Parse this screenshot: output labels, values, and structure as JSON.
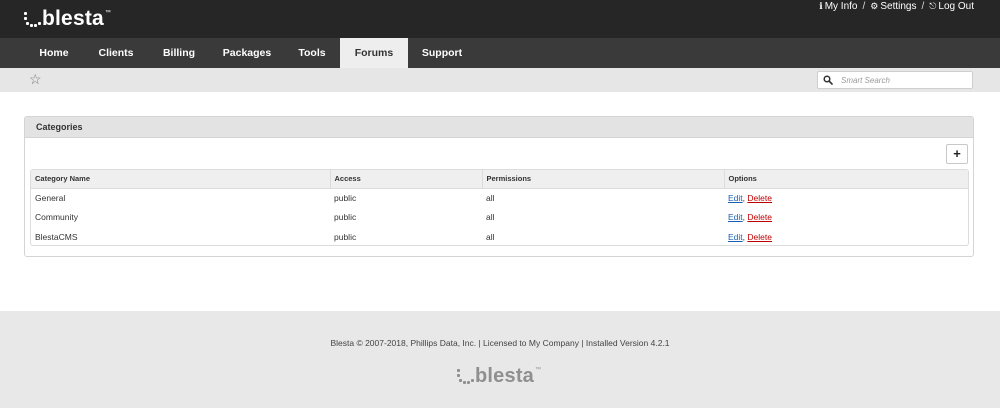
{
  "header": {
    "logo_text": "blesta",
    "logo_tm": "™",
    "links": [
      {
        "label": "My Info",
        "icon": "info-icon"
      },
      {
        "label": "Settings",
        "icon": "gear-icon"
      },
      {
        "label": "Log Out",
        "icon": "logout-icon"
      }
    ],
    "separator": "/"
  },
  "nav": {
    "tabs": [
      {
        "label": "Home"
      },
      {
        "label": "Clients"
      },
      {
        "label": "Billing"
      },
      {
        "label": "Packages"
      },
      {
        "label": "Tools"
      },
      {
        "label": "Forums",
        "active": true
      },
      {
        "label": "Support"
      }
    ]
  },
  "subbar": {
    "star_icon": "star-icon",
    "search_placeholder": "Smart Search"
  },
  "panel": {
    "title": "Categories",
    "add_button": "+",
    "columns": [
      "Category Name",
      "Access",
      "Permissions",
      "Options"
    ],
    "rows": [
      {
        "name": "General",
        "access": "public",
        "permissions": "all",
        "edit": "Edit",
        "comma": ",",
        "delete": "Delete"
      },
      {
        "name": "Community",
        "access": "public",
        "permissions": "all",
        "edit": "Edit",
        "comma": ",",
        "delete": "Delete"
      },
      {
        "name": "BlestaCMS",
        "access": "public",
        "permissions": "all",
        "edit": "Edit",
        "comma": ",",
        "delete": "Delete"
      }
    ]
  },
  "footer": {
    "text": "Blesta © 2007-2018, Phillips Data, Inc. | Licensed to My Company | Installed Version 4.2.1",
    "logo_text": "blesta",
    "logo_tm": "™"
  },
  "colors": {
    "topbar": "#262626",
    "navbar": "#3a3a3a",
    "link_edit": "#1a5fb4",
    "link_delete": "#c00000"
  }
}
